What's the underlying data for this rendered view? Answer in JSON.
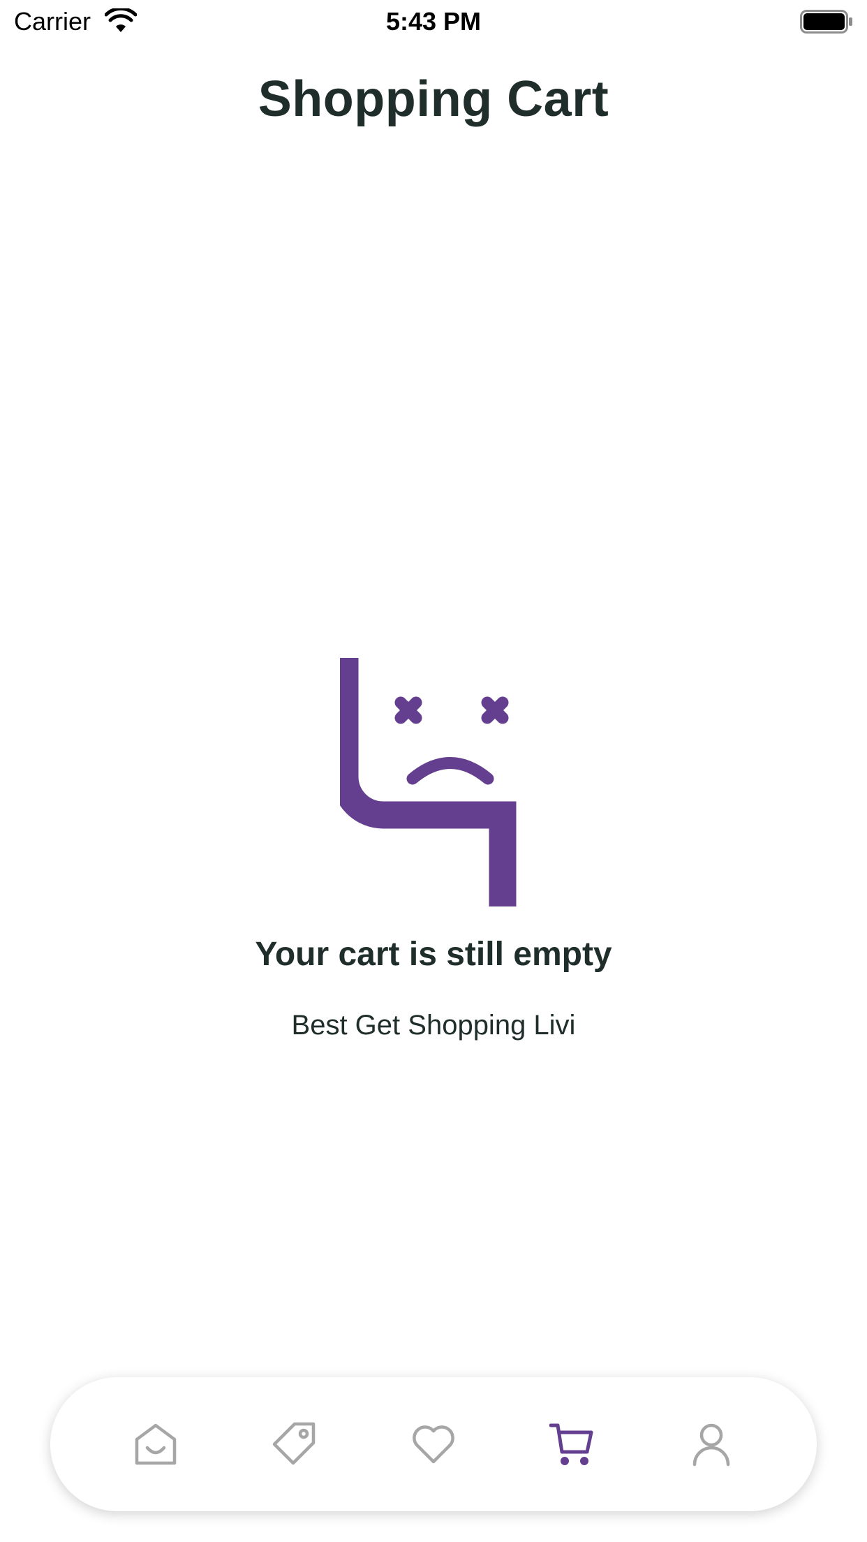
{
  "status_bar": {
    "carrier": "Carrier",
    "time": "5:43 PM"
  },
  "header": {
    "title": "Shopping Cart"
  },
  "empty_state": {
    "title": "Your cart is still empty",
    "subtitle": "Best Get Shopping Livi",
    "illustration_icon": "sad-cart-face-icon"
  },
  "tab_bar": {
    "items": [
      {
        "icon": "home-icon",
        "active": false
      },
      {
        "icon": "tag-icon",
        "active": false
      },
      {
        "icon": "heart-icon",
        "active": false
      },
      {
        "icon": "cart-icon",
        "active": true
      },
      {
        "icon": "profile-icon",
        "active": false
      }
    ]
  },
  "colors": {
    "accent": "#643f8f",
    "text": "#1f2d2b",
    "inactive_icon": "#a6a6a6",
    "background": "#ffffff"
  }
}
